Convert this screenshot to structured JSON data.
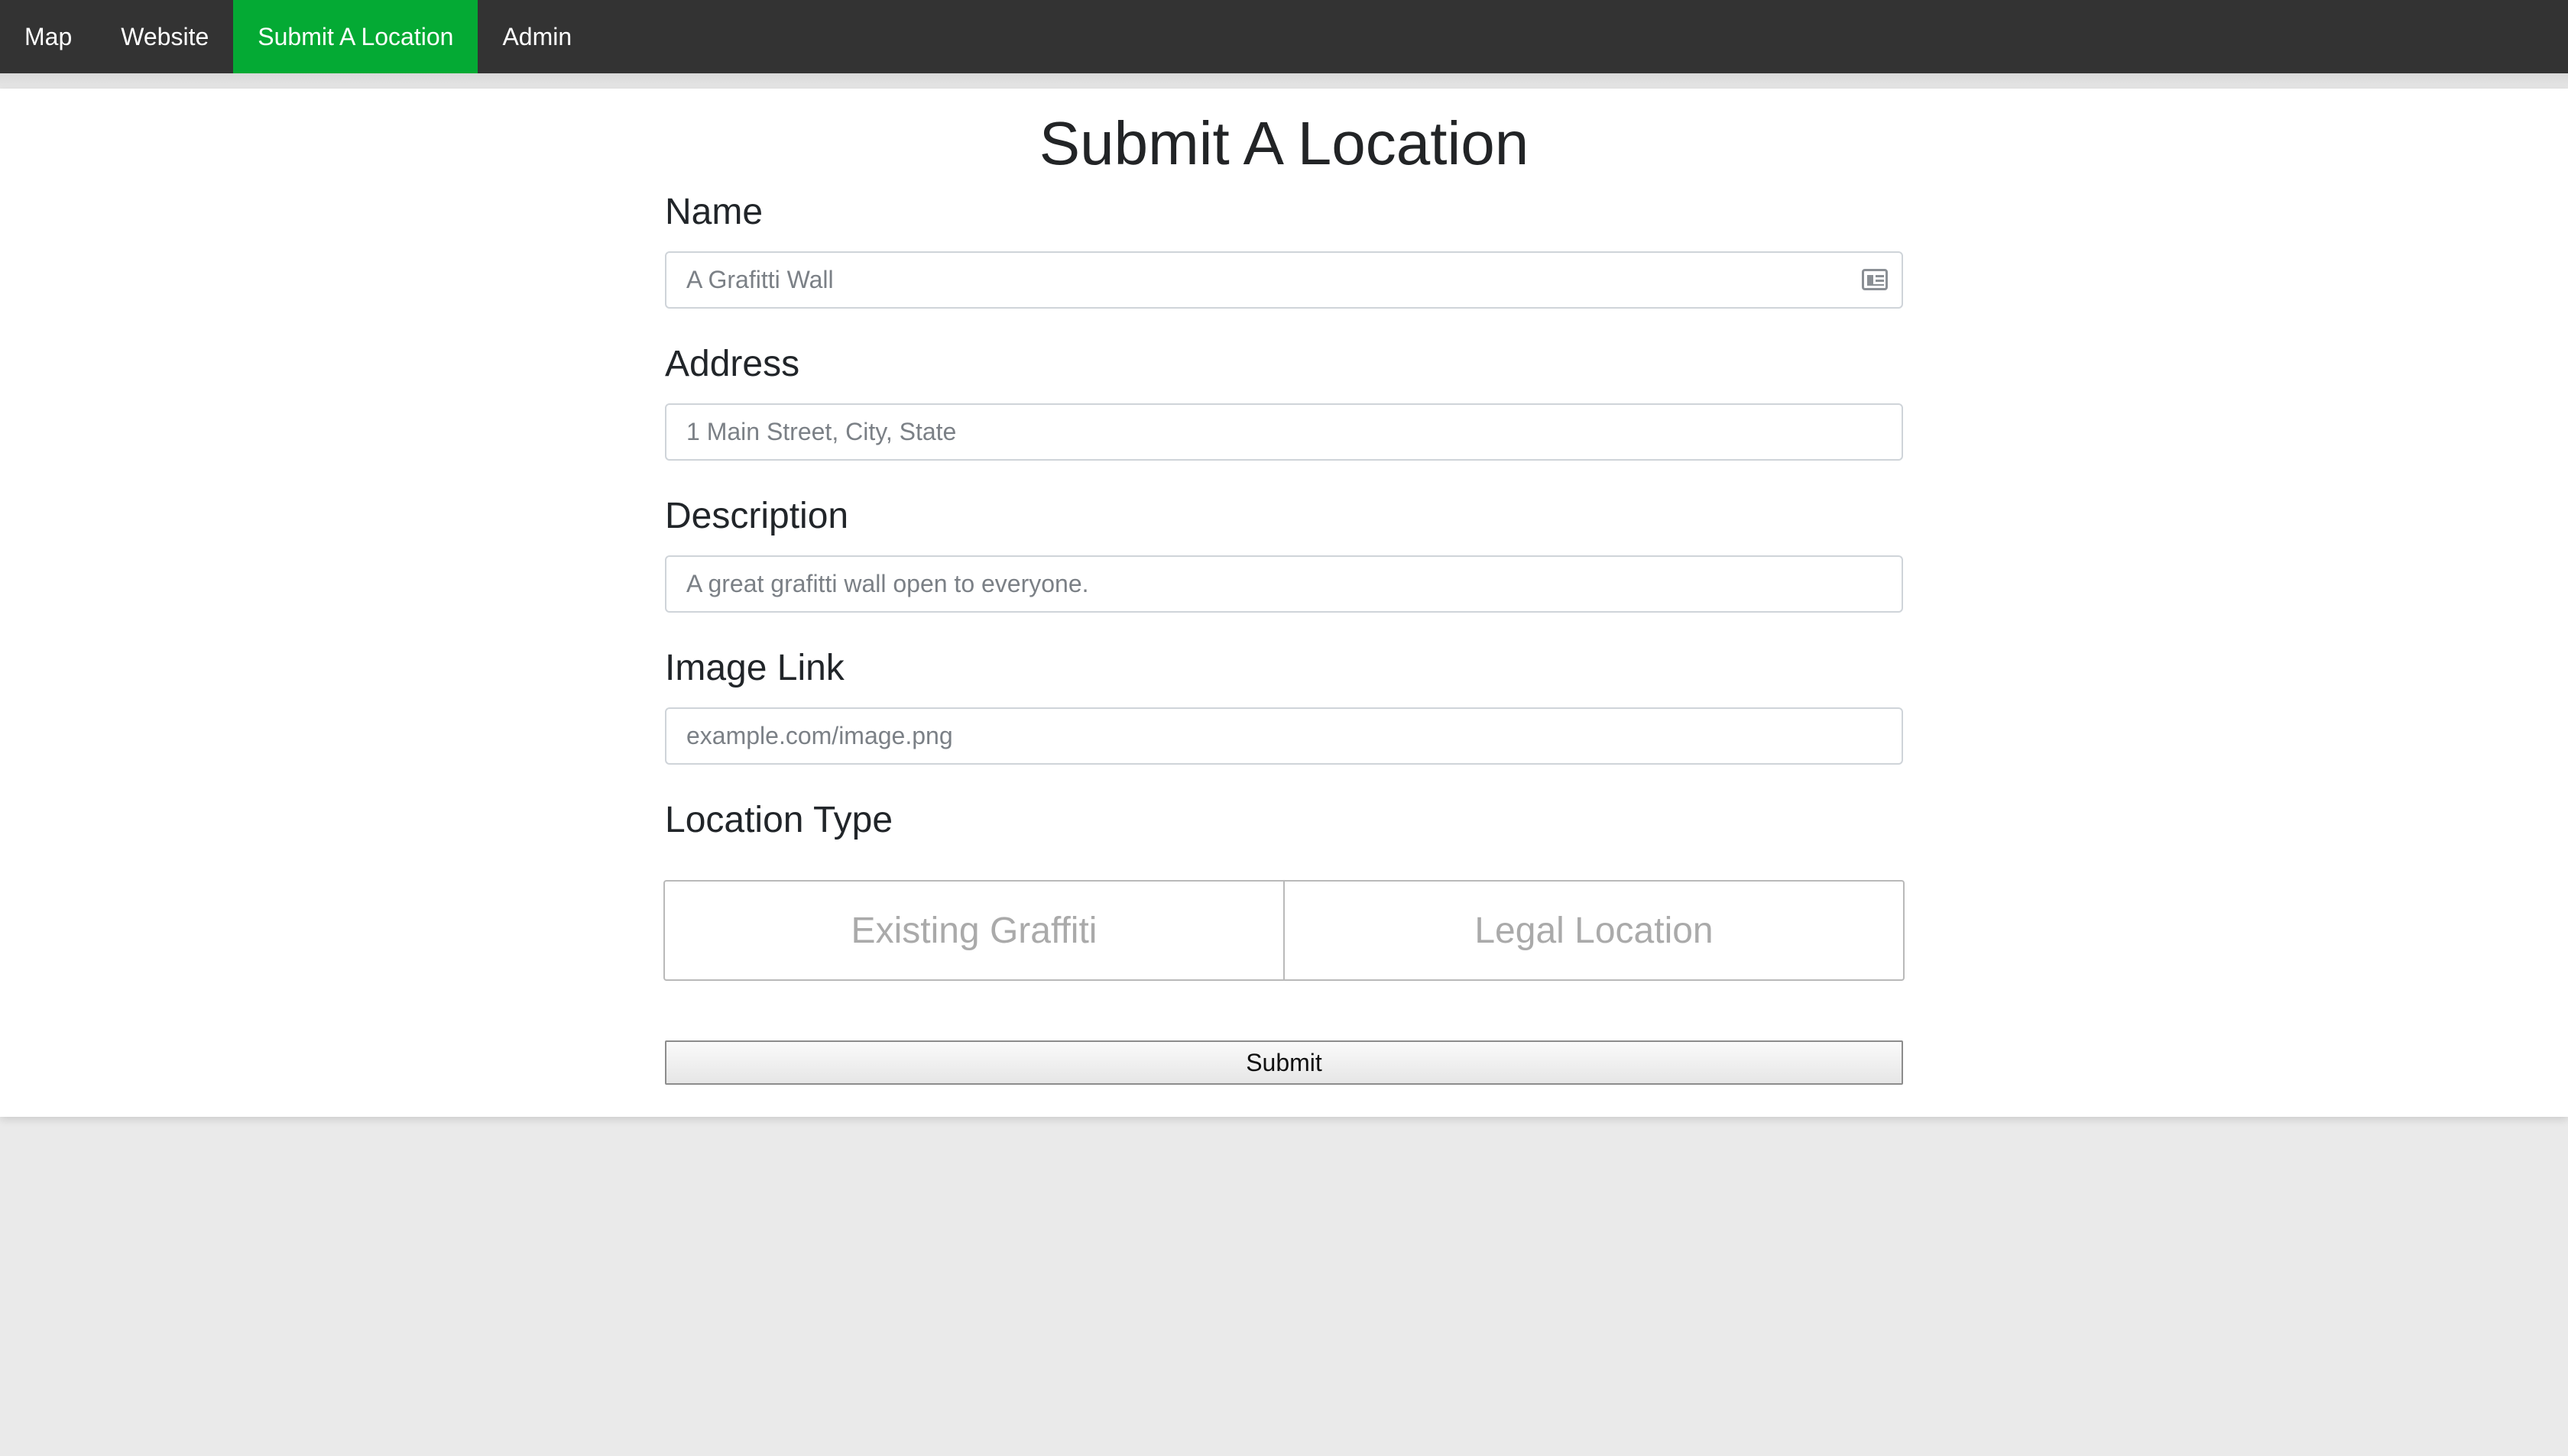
{
  "nav": {
    "items": [
      {
        "label": "Map"
      },
      {
        "label": "Website"
      },
      {
        "label": "Submit A Location",
        "active": true
      },
      {
        "label": "Admin"
      }
    ]
  },
  "page": {
    "title": "Submit A Location"
  },
  "form": {
    "name": {
      "label": "Name",
      "placeholder": "A Grafitti Wall",
      "icon": "contact-card-icon"
    },
    "address": {
      "label": "Address",
      "placeholder": "1 Main Street, City, State"
    },
    "description": {
      "label": "Description",
      "placeholder": "A great grafitti wall open to everyone."
    },
    "image_link": {
      "label": "Image Link",
      "placeholder": "example.com/image.png"
    },
    "location_type": {
      "label": "Location Type",
      "options": [
        "Existing Graffiti",
        "Legal Location"
      ]
    },
    "submit_label": "Submit"
  },
  "colors": {
    "nav_bg": "#333333",
    "nav_active": "#04aa34",
    "page_bg": "#eaeaea",
    "panel_bg": "#ffffff"
  }
}
